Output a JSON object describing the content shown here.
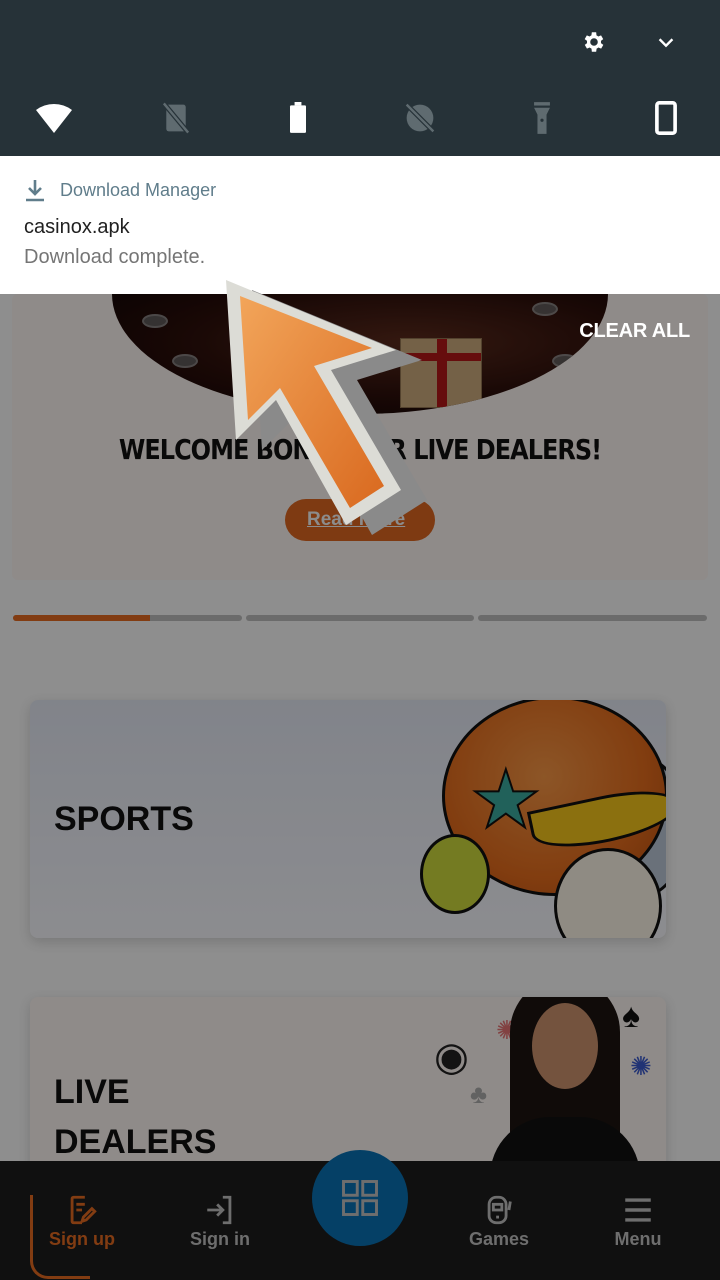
{
  "status_shade": {
    "top_icons": [
      "settings-icon",
      "chevron-down-icon"
    ],
    "quick_settings": [
      {
        "name": "wifi",
        "icon": "wifi-icon",
        "active": true
      },
      {
        "name": "mobile-data",
        "icon": "sim-off-icon",
        "active": false
      },
      {
        "name": "battery-saver",
        "icon": "battery-icon",
        "active": true
      },
      {
        "name": "do-not-disturb",
        "icon": "dnd-off-icon",
        "active": false
      },
      {
        "name": "flashlight",
        "icon": "flashlight-icon",
        "active": false
      },
      {
        "name": "auto-rotate",
        "icon": "phone-rotate-icon",
        "active": true
      }
    ]
  },
  "notification": {
    "app_name": "Download Manager",
    "title": "casinox.apk",
    "text": "Download complete."
  },
  "clear_all_label": "CLEAR ALL",
  "hero": {
    "title": "WELCOME BONUS FOR LIVE DEALERS!",
    "button_label": "Read more",
    "slides_total": 3,
    "active_slide": 1,
    "active_progress_fraction": 0.6
  },
  "cards": [
    {
      "title": "SPORTS"
    },
    {
      "title_line1": "LIVE",
      "title_line2": "DEALERS"
    }
  ],
  "bottom_nav": {
    "items": [
      {
        "label": "Sign up",
        "icon": "sign-up-icon",
        "active": true
      },
      {
        "label": "Sign in",
        "icon": "sign-in-icon",
        "active": false
      },
      {
        "label": "",
        "icon": "grid-icon",
        "active": false
      },
      {
        "label": "Games",
        "icon": "slot-machine-icon",
        "active": false
      },
      {
        "label": "Menu",
        "icon": "hamburger-menu-icon",
        "active": false
      }
    ]
  },
  "colors": {
    "accent": "#e0681f",
    "shade_bg": "#263238",
    "fab": "#0a6fb0",
    "nav_bg": "#1c1c1c"
  }
}
